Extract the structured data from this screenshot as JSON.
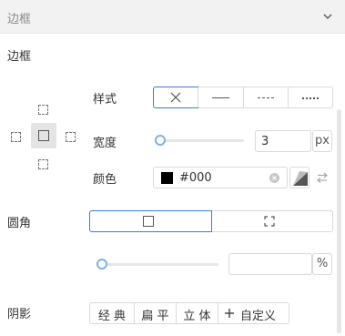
{
  "header": {
    "title": "边框",
    "collapse_icon": "chevron-down-icon"
  },
  "border": {
    "section_title": "边框",
    "style_label": "样式",
    "style_options": [
      {
        "name": "none",
        "icon": "x-icon",
        "selected": true
      },
      {
        "name": "solid",
        "icon": "solid-line-icon",
        "selected": false
      },
      {
        "name": "dashed",
        "icon": "dashed-line-icon",
        "selected": false
      },
      {
        "name": "dotted",
        "icon": "dotted-line-icon",
        "selected": false
      }
    ],
    "width_label": "宽度",
    "width_value": "3",
    "width_unit": "px",
    "color_label": "颜色",
    "color_value": "#000",
    "color_swatch": "#000000"
  },
  "radius": {
    "label": "圆角",
    "options": [
      {
        "name": "uniform",
        "icon": "square-icon",
        "selected": true
      },
      {
        "name": "per-corner",
        "icon": "corners-icon",
        "selected": false
      }
    ],
    "value": "",
    "unit": "%"
  },
  "shadow": {
    "label": "阴影",
    "options": [
      "经 典",
      "扁 平",
      "立 体",
      "自定义"
    ],
    "custom_icon": "plus-icon"
  },
  "colors": {
    "accent": "#3b7ddd",
    "slider_knob": "#7fb0e8",
    "border": "#d9d9d9",
    "header_bg": "#f2f2f2"
  }
}
